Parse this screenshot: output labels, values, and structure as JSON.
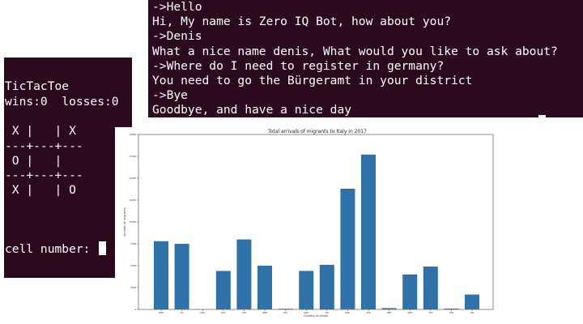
{
  "chat_terminal": {
    "lines": [
      "->Hello",
      "Hi, My name is Zero IQ Bot, how about you?",
      "->Denis",
      "What a nice name denis, What would you like to ask about?",
      "->Where do I need to register in germany?",
      "You need to go the Bürgeramt in your district",
      "->Bye",
      "Goodbye, and have a nice day"
    ]
  },
  "ttt_terminal": {
    "title": "TicTacToe",
    "score": "wins:0  losses:0",
    "board": [
      " X |   | X",
      "---+---+---",
      " O |   |",
      "---+---+---",
      " X |   | O"
    ],
    "prompt": "cell number: "
  },
  "chart_data": {
    "type": "bar",
    "title": "Total arrivals of migrants to Italy in 2017",
    "xlabel": "Country of origin",
    "ylabel": "Arrivals of migrants",
    "ylim": [
      0,
      20000
    ],
    "yticks": [
      0,
      2500,
      5000,
      7500,
      10000,
      12500,
      15000,
      17500,
      20000
    ],
    "yticklabels": [
      "0",
      "2500",
      "5000",
      "7500",
      "10000",
      "12500",
      "15000",
      "17500",
      "20000"
    ],
    "categories": [
      "BGD",
      "CIV",
      "DZA",
      "EGY",
      "GIN",
      "GMB",
      "IRQ",
      "MAR",
      "MLI",
      "NGA",
      "PAK",
      "SEN",
      "SDN",
      "SYR",
      "TUN",
      "LBY"
    ],
    "values": [
      7800,
      7500,
      30,
      4400,
      8000,
      5000,
      80,
      4400,
      5100,
      13800,
      17700,
      150,
      4000,
      4900,
      100,
      1700
    ],
    "bar_color": "#2f72aa",
    "grid": false
  }
}
